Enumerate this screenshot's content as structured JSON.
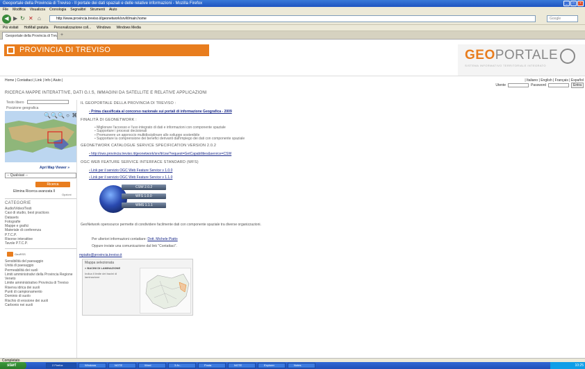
{
  "window": {
    "title": "Geoportale della Provincia di Treviso - Il portale dei dati spaziali e delle relative informazioni - Mozilla Firefox",
    "controls": [
      "_",
      "□",
      "×"
    ]
  },
  "menubar": [
    "File",
    "Modifica",
    "Visualizza",
    "Cronologia",
    "Segnalibri",
    "Strumenti",
    "Aiuto"
  ],
  "toolbar": {
    "url": "http://www.provincia.treviso.it/geonetwork/srv/it/main.home",
    "search_placeholder": "Google"
  },
  "bookmarks": [
    "Più visitati",
    "HotMail gratuita",
    "Personalizzazione coll...",
    "Windows",
    "Windows Media"
  ],
  "tab": {
    "label": "Geoportale della Provincia di Trevis...",
    "new": "+"
  },
  "header": {
    "province": "PROVINCIA DI TREVISO",
    "geo_prefix": "GEO",
    "geo_suffix": "PORTALE",
    "geo_subtitle": "SISTEMA INFORMATIVO TERRITORIALE INTEGRATO",
    "top_nav": "Home | Contattaci | Link | Info | Aiuto |",
    "languages": "| Italiano | English | Français | Español",
    "username_label": "Utente",
    "password_label": "Password",
    "login_label": "Entra"
  },
  "section_heading": "RICERCA MAPPE INTERATTIVE, DATI G.I.S, IMMAGINI DA SATELLITE E RELATIVE APPLICAZIONI",
  "sidebar": {
    "free_text_label": "Testo libero",
    "geo_position_label": "Posizione geografica",
    "map_viewer_link": "Apri Map Viewer »",
    "select_value": "-- Qualsiasi --",
    "search_button": "Ricerca",
    "links": "Elimina  Ricerca avanzata  Il",
    "options": "Opzioni",
    "categories_title": "CATEGORIE",
    "categories": [
      "Audio/Video/Testi",
      "Casi di studio, best practices",
      "Datasets",
      "Fotografie",
      "Mappe e grafici",
      "Materiale di conferenza",
      "P.T.C.P.",
      "Risorse interattive",
      "Tavole P.T.C.P."
    ],
    "rss_label": "GeoRSS",
    "rss_items": [
      "Sensibilità del paesaggio",
      "Unità di paesaggio",
      "Permeabilità dei suoli",
      "Limiti amministrativi della Provincia Regione Veneto",
      "Limite amministrativo Provincia di Treviso",
      "Riserva idrica dei suoli",
      "Punti di campionamento",
      "Dominio di suolo",
      "Rischio di erosione dei suoli",
      "Carbonio nei suoli"
    ]
  },
  "main": {
    "intro_title": "IL GEOPORTALE DELLA PROVINCIA DI TREVISO :",
    "award_link": "Prima classificata al concorso nazionale sui portali di informazione Geografica - 2009",
    "goals_title": "FINALITÀ DI GEONETWORK :",
    "goals": [
      "Migliorare l'accesso e l'uso integrato di dati e informazioni con componente spaziale",
      "Supportare i processi decisionali",
      "Promuovere un approccio multidisciplinare allo sviluppo sostenibile",
      "Supportare la comprensione dei benefici derivanti dall'impiego dei dati con componente spaziale"
    ],
    "csw_title": "GEONETWORK CATALOGUE SERVICE SPECIFICATION VERSION 2.0.2",
    "csw_link": "http://ows.provincia.treviso.it/geonetwork/srv/it/csw?request=GetCapabilities&service=CSW",
    "wfs_title": "OGC WEB FEATURE SERVICE INTERFACE STANDARD (WFS)",
    "wfs_links": [
      "Link per il servizio OGC Web Feature Service v 1.0.0",
      "Link per il servizio OGC Web Feature Service v 1.1.0"
    ],
    "badges": [
      "CSW 2.0.2",
      "WFS 1.0.0",
      "WMS 1.1.1"
    ],
    "description": "GeoNetwork opensource permette di condividere facilmente dati con componente spaziale tra diverse organizzazioni.",
    "contact_line": "Per ulteriori informazioni contattare:",
    "contact_name": "Dott. Michele Piatto",
    "contact_line2": "Oppure inviate una comunicazione dal link \"Contattaci\".",
    "email": "mpiatto@provincia.treviso.it",
    "featured_map": {
      "title": "Mappa selezionata",
      "name": "» BACINI DI LAMINAZIONE",
      "desc": "Indica il limite dei bacini di laminazione"
    }
  },
  "statusbar": "Completato",
  "taskbar": {
    "start": "start",
    "buttons": [
      "2 Firefox",
      "Windows",
      "NOTE",
      "Word",
      "3 Ar...",
      "Posta",
      "NOTE",
      "Explorer",
      "Notes"
    ],
    "clock": "10:25"
  },
  "colors": {
    "accent": "#e87d1e",
    "link": "#1a2a8a",
    "titlebar": "#2456c8"
  }
}
